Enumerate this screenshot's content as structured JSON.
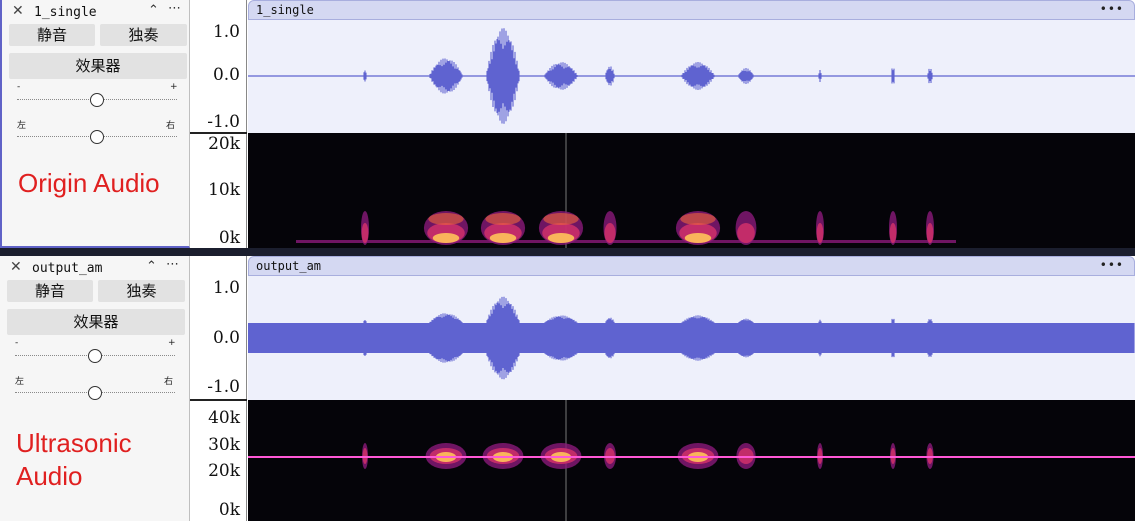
{
  "tracks": [
    {
      "name": "1_single",
      "close_glyph": "✕",
      "collapse_glyph": "⌃",
      "menu_glyph": "⋯",
      "mute_label": "静音",
      "solo_label": "独奏",
      "effects_label": "效果器",
      "gain_minus": "-",
      "gain_plus": "+",
      "pan_left": "左",
      "pan_right": "右",
      "gain_level": 0.5,
      "pan_level": 0.5,
      "annotation": "Origin Audio",
      "clip_title": "1_single",
      "clip_menu": "•••",
      "wave_labels": {
        "top": "1.0",
        "mid": "0.0",
        "bottom": "-1.0"
      },
      "spec_labels": [
        "20k",
        "10k",
        "0k"
      ]
    },
    {
      "name": "output_am",
      "close_glyph": "✕",
      "collapse_glyph": "⌃",
      "menu_glyph": "⋯",
      "mute_label": "静音",
      "solo_label": "独奏",
      "effects_label": "效果器",
      "gain_minus": "-",
      "gain_plus": "+",
      "pan_left": "左",
      "pan_right": "右",
      "gain_level": 0.5,
      "pan_level": 0.5,
      "annotation_lines": [
        "Ultrasonic",
        "Audio"
      ],
      "clip_title": "output_am",
      "clip_menu": "•••",
      "wave_labels": {
        "top": "1.0",
        "mid": "0.0",
        "bottom": "-1.0"
      },
      "spec_labels": [
        "40k",
        "30k",
        "20k",
        "0k"
      ]
    }
  ],
  "colors": {
    "waveform": "#5f63d0",
    "wave_bg": "#eef0fb",
    "clip_header": "#d4d8f2",
    "spectrogram_bg": "#050409",
    "carrier_line": "#ff58d6",
    "annotation": "#e02020",
    "selection_border": "#6062c7"
  }
}
